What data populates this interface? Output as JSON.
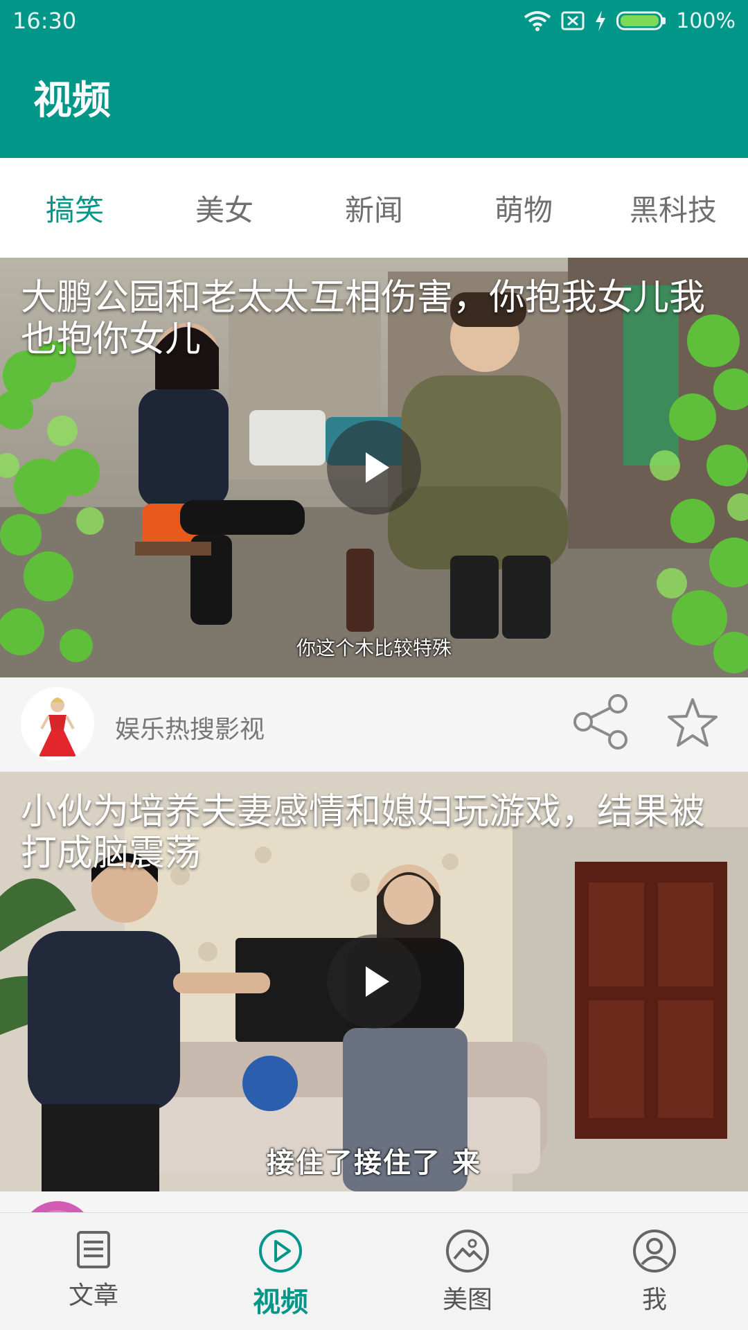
{
  "status_bar": {
    "time": "16:30",
    "battery_percent": "100%",
    "icons": [
      "wifi-icon",
      "sim-off-icon",
      "charging-icon",
      "battery-icon"
    ]
  },
  "app_bar": {
    "title": "视频"
  },
  "tabs": [
    {
      "label": "搞笑",
      "active": true
    },
    {
      "label": "美女",
      "active": false
    },
    {
      "label": "新闻",
      "active": false
    },
    {
      "label": "萌物",
      "active": false
    },
    {
      "label": "黑科技",
      "active": false
    }
  ],
  "feed": [
    {
      "title": "大鹏公园和老太太互相伤害，你抱我女儿我也抱你女儿",
      "subtitle": "你这个木比较特殊",
      "author": "娱乐热搜影视"
    },
    {
      "title": "小伙为培养夫妻感情和媳妇玩游戏，结果被打成脑震荡",
      "subtitle": "接住了接住了  来"
    }
  ],
  "bottom_nav": [
    {
      "label": "文章",
      "icon": "article-icon",
      "active": false
    },
    {
      "label": "视频",
      "icon": "video-play-icon",
      "active": true
    },
    {
      "label": "美图",
      "icon": "image-icon",
      "active": false
    },
    {
      "label": "我",
      "icon": "profile-icon",
      "active": false
    }
  ],
  "colors": {
    "primary": "#009688",
    "tab_inactive": "#6f6f6f",
    "meta_bg": "#f5f5f5"
  }
}
